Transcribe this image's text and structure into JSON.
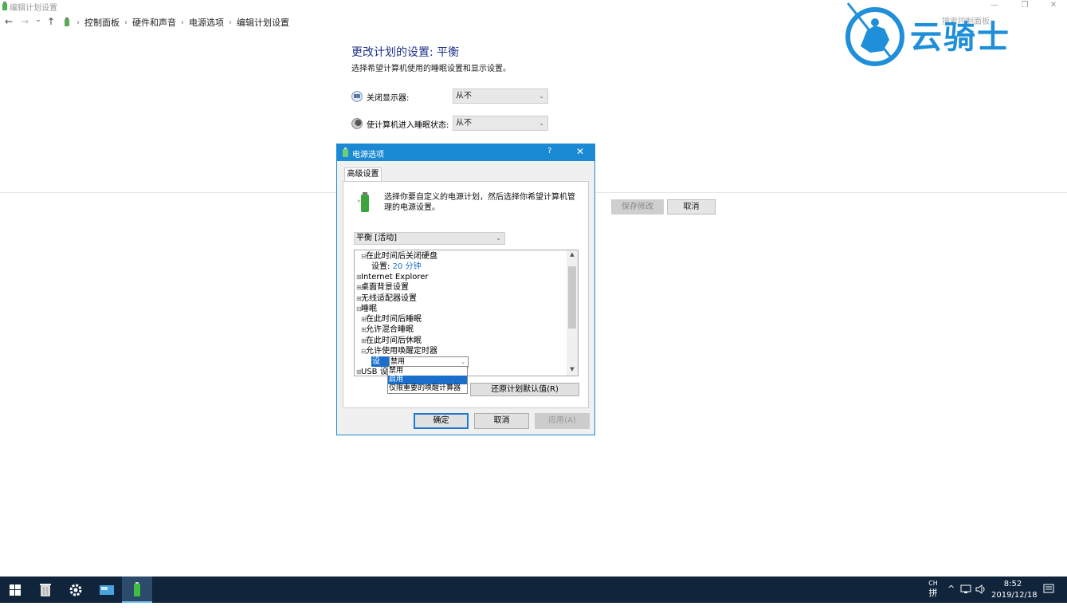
{
  "window": {
    "title": "编辑计划设置",
    "minimize": "—",
    "restore": "❐",
    "close": "✕"
  },
  "address_bar": {
    "back": "←",
    "forward": "→",
    "recent": "⌄",
    "up": "↑",
    "crumbs": [
      "控制面板",
      "硬件和声音",
      "电源选项",
      "编辑计划设置"
    ],
    "separator": "›",
    "search_placeholder": "搜索控制面板"
  },
  "main": {
    "title": "更改计划的设置: 平衡",
    "subtitle": "选择希望计算机使用的睡眠设置和显示设置。",
    "display_label": "关闭显示器:",
    "display_value": "从不",
    "sleep_label": "使计算机进入睡眠状态:",
    "sleep_value": "从不",
    "save_button": "保存修改",
    "cancel_button": "取消"
  },
  "dialog": {
    "title": "电源选项",
    "help": "?",
    "close": "✕",
    "tab": "高级设置",
    "description": "选择你要自定义的电源计划，然后选择你希望计算机管理的电源设置。",
    "plan_value": "平衡 [活动]",
    "tree": [
      {
        "toggle": "⊟",
        "label": "在此时间后关闭硬盘",
        "indent": 1
      },
      {
        "toggle": "",
        "label": "设置:",
        "value": "20 分钟",
        "indent": 2
      },
      {
        "toggle": "⊞",
        "label": "Internet Explorer",
        "indent": 0
      },
      {
        "toggle": "⊞",
        "label": "桌面背景设置",
        "indent": 0
      },
      {
        "toggle": "⊞",
        "label": "无线适配器设置",
        "indent": 0
      },
      {
        "toggle": "⊟",
        "label": "睡眠",
        "indent": 0
      },
      {
        "toggle": "⊞",
        "label": "在此时间后睡眠",
        "indent": 1
      },
      {
        "toggle": "⊞",
        "label": "允许混合睡眠",
        "indent": 1
      },
      {
        "toggle": "⊞",
        "label": "在此时间后休眠",
        "indent": 1
      },
      {
        "toggle": "⊟",
        "label": "允许使用唤醒定时器",
        "indent": 1
      },
      {
        "toggle": "⊞",
        "label": "USB 设置",
        "indent": 0
      }
    ],
    "inline_setting_label": "设置:",
    "inline_setting_value": "禁用",
    "dropdown_options": [
      "禁用",
      "启用",
      "仅限重要的唤醒计算器"
    ],
    "restore_button": "还原计划默认值(R)",
    "ok_button": "确定",
    "cancel_button": "取消",
    "apply_button": "应用(A)"
  },
  "watermark": {
    "text": "云骑士"
  },
  "taskbar": {
    "apps": [
      "start-icon",
      "recycle-bin-icon",
      "settings-icon",
      "control-panel-icon",
      "power-options-icon"
    ],
    "ime_top": "CH",
    "ime_bottom": "拼",
    "chevron": "^",
    "time": "8:52",
    "date": "2019/12/18"
  },
  "colors": {
    "accent": "#1a8ad4",
    "title_blue": "#1e3287",
    "taskbar": "#10243c",
    "selection": "#1a6fcc",
    "watermark": "#1e8fd8"
  }
}
